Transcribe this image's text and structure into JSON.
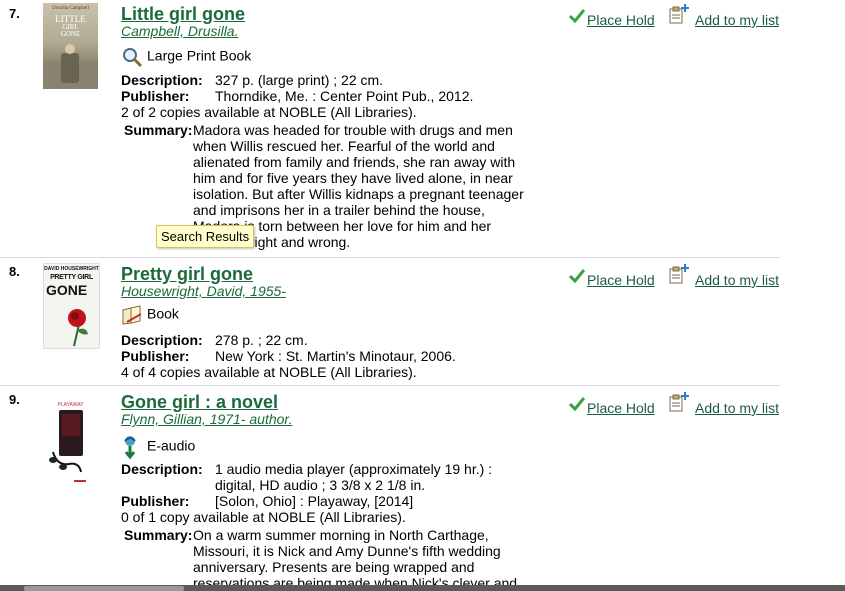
{
  "results": [
    {
      "number": "7.",
      "title": "Little girl gone",
      "author": "Campbell, Drusilla.",
      "format": "Large Print Book",
      "description_label": "Description:",
      "description": "327 p. (large print) ; 22 cm.",
      "publisher_label": "Publisher:",
      "publisher": "Thorndike, Me. : Center Point Pub., 2012.",
      "availability": "2 of 2 copies available at NOBLE (All Libraries).",
      "summary_label": "Summary:",
      "summary_lines": [
        "Madora was headed for trouble with drugs and men",
        "when Willis rescued her. Fearful of the world and",
        "alienated from family and friends, she ran away with",
        "him and for five years they have lived alone, in near",
        "isolation. But after Willis kidnaps a pregnant teenager",
        "and imprisons her in a trailer behind the house,",
        "Madora is torn between her love for him and her",
        "sense of right and wrong."
      ],
      "cover_text": [
        "Drusilla Campbell",
        "LITTLE",
        "GIRL",
        "GONE"
      ],
      "place_hold": "Place Hold",
      "add_to_list": "Add to my list"
    },
    {
      "number": "8.",
      "title": "Pretty girl gone",
      "author": "Housewright, David, 1955-",
      "format": "Book",
      "description_label": "Description:",
      "description": "278 p. ; 22 cm.",
      "publisher_label": "Publisher:",
      "publisher": "New York : St. Martin's Minotaur, 2006.",
      "availability": "4 of 4 copies available at NOBLE (All Libraries).",
      "cover_text": [
        "DAVID HOUSEWRIGHT",
        "PRETTY GIRL",
        "GONE"
      ],
      "place_hold": "Place Hold",
      "add_to_list": "Add to my list"
    },
    {
      "number": "9.",
      "title": "Gone girl : a novel",
      "author": "Flynn, Gillian, 1971- author.",
      "format": "E-audio",
      "description_label": "Description:",
      "description_lines": [
        "1 audio media player (approximately 19 hr.) :",
        "digital, HD audio ; 3 3/8 x 2 1/8 in."
      ],
      "publisher_label": "Publisher:",
      "publisher": "[Solon, Ohio] : Playaway, [2014]",
      "availability": "0 of 1 copy available at NOBLE (All Libraries).",
      "summary_label": "Summary:",
      "summary_lines": [
        "On a warm summer morning in North Carthage,",
        "Missouri, it is Nick and Amy Dunne's fifth wedding",
        "anniversary. Presents are being wrapped and",
        "reservations are being made when Nick's clever and"
      ],
      "cover_text": [
        "PLAYAWAY"
      ],
      "place_hold": "Place Hold",
      "add_to_list": "Add to my list"
    }
  ],
  "tooltip": "Search Results",
  "colors": {
    "link": "#1a6a3a",
    "check": "#3aa33a",
    "tooltip_bg": "#ffffcc"
  }
}
